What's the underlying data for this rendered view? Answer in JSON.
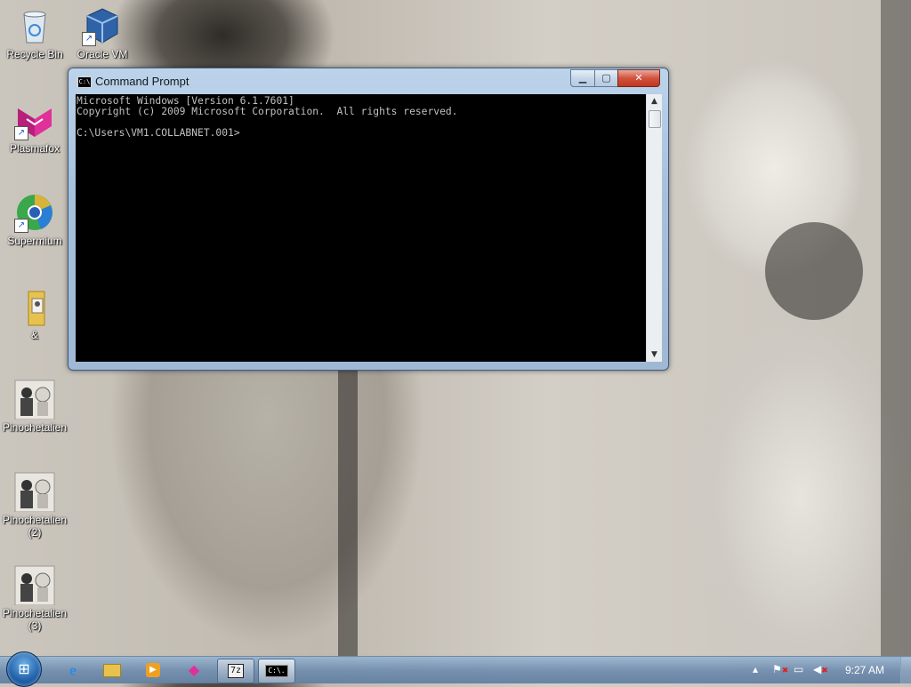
{
  "desktop": {
    "icons": [
      {
        "label": "Recycle Bin",
        "icon": "recycle-bin-icon"
      },
      {
        "label": "Oracle VM",
        "icon": "virtualbox-icon"
      },
      {
        "label": "Plasmafox",
        "icon": "plasmafox-icon"
      },
      {
        "label": "Supermium",
        "icon": "supermium-icon"
      },
      {
        "label": "&",
        "icon": "folder-icon"
      },
      {
        "label": "Pinochetalien",
        "icon": "image-thumbnail-icon"
      },
      {
        "label": "Pinochetalien\n(2)",
        "icon": "image-thumbnail-icon"
      },
      {
        "label": "Pinochetalien\n(3)",
        "icon": "image-thumbnail-icon"
      }
    ]
  },
  "window": {
    "title": "Command Prompt",
    "console_lines": [
      "Microsoft Windows [Version 6.1.7601]",
      "Copyright (c) 2009 Microsoft Corporation.  All rights reserved.",
      "",
      "C:\\Users\\VM1.COLLABNET.001>"
    ],
    "console_text": "Microsoft Windows [Version 6.1.7601]\nCopyright (c) 2009 Microsoft Corporation.  All rights reserved.\n\nC:\\Users\\VM1.COLLABNET.001>"
  },
  "taskbar": {
    "items": [
      {
        "icon": "internet-explorer-icon",
        "running": false
      },
      {
        "icon": "file-explorer-icon",
        "running": false
      },
      {
        "icon": "media-player-icon",
        "running": false
      },
      {
        "icon": "plasmafox-icon",
        "running": false
      },
      {
        "icon": "7zip-icon",
        "running": true,
        "label": "7z"
      },
      {
        "icon": "command-prompt-icon",
        "running": true,
        "active": true,
        "label": "C:\\."
      }
    ],
    "tray_icons": [
      "show-hidden-icons",
      "action-center-flag-icon",
      "network-icon",
      "volume-muted-icon"
    ],
    "clock": "9:27 AM"
  }
}
